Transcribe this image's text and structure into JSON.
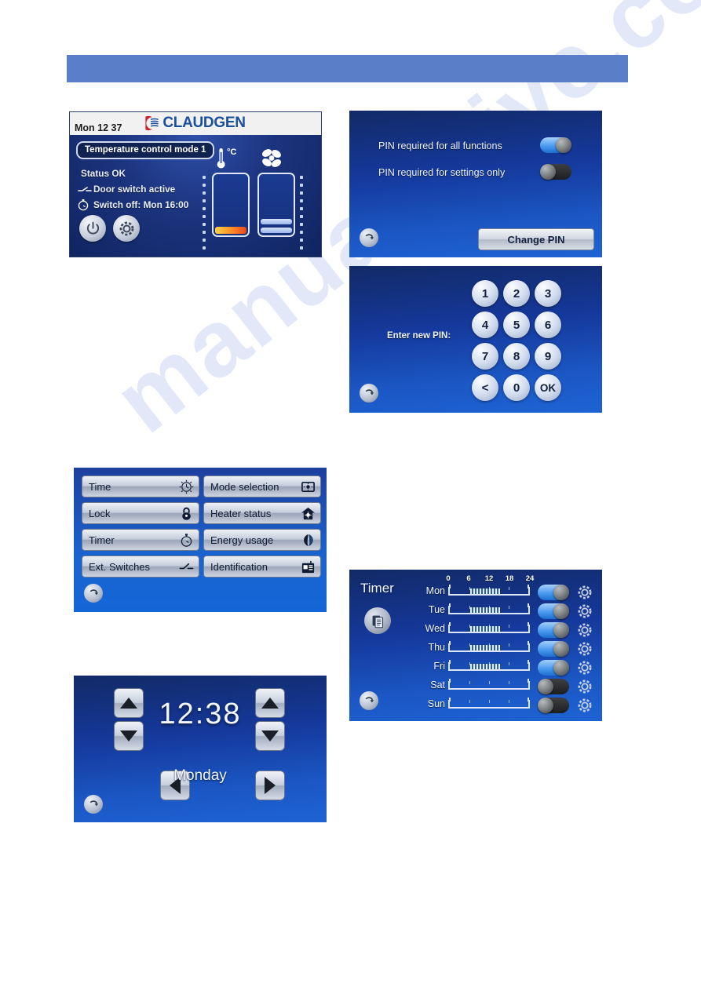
{
  "watermark": "manualshive.com",
  "panel_status": {
    "name": "main-status-screen",
    "clock": "Mon 12 37",
    "brand": "CLAUDGEN",
    "mode_label": "Temperature control mode 1",
    "status_line": "Status OK",
    "door_line": "Door switch active",
    "switchoff_line": "Switch off: Mon 16:00",
    "unit_label": "°C",
    "power_button": "power-icon",
    "settings_button": "gear-icon",
    "temp_gauge_fill_pct": 11,
    "fan_gauge_fill_pcts": [
      9,
      9
    ]
  },
  "panel_pin": {
    "name": "pin-settings-screen",
    "row_all_functions": "PIN required for all functions",
    "row_settings_only": "PIN required for settings only",
    "toggle_all_functions": "on",
    "toggle_settings_only": "off",
    "change_pin_label": "Change PIN",
    "back_label": "back-icon"
  },
  "panel_keypad": {
    "name": "enter-pin-screen",
    "prompt": "Enter new PIN:",
    "keys": [
      "1",
      "2",
      "3",
      "4",
      "5",
      "6",
      "7",
      "8",
      "9",
      "<",
      "0",
      "OK"
    ],
    "back_label": "back-icon"
  },
  "panel_menu": {
    "name": "settings-menu-screen",
    "items_left": [
      {
        "label": "Time",
        "icon": "clock-icon"
      },
      {
        "label": "Lock",
        "icon": "padlock-icon"
      },
      {
        "label": "Timer",
        "icon": "stopwatch-icon"
      },
      {
        "label": "Ext. Switches",
        "icon": "switch-icon"
      }
    ],
    "items_right": [
      {
        "label": "Mode selection",
        "icon": "mode-display-icon"
      },
      {
        "label": "Heater status",
        "icon": "house-heater-icon"
      },
      {
        "label": "Energy usage",
        "icon": "leaf-icon"
      },
      {
        "label": "Identification",
        "icon": "id-card-icon"
      }
    ],
    "back_label": "back-icon"
  },
  "panel_time": {
    "name": "time-setting-screen",
    "time": "12:38",
    "day": "Monday",
    "hour_up": "arrow-up-icon",
    "hour_down": "arrow-down-icon",
    "minute_up": "arrow-up-icon",
    "minute_down": "arrow-down-icon",
    "day_prev": "arrow-left-icon",
    "day_next": "arrow-right-icon",
    "back_label": "back-icon"
  },
  "panel_timer": {
    "name": "timer-schedule-screen",
    "title": "Timer",
    "copy_button": "copy-icon",
    "back_label": "back-icon",
    "scale_ticks": [
      "0",
      "6",
      "12",
      "18",
      "24"
    ],
    "days": [
      {
        "name": "Mon",
        "enabled": true,
        "start_pct": 26,
        "end_pct": 64
      },
      {
        "name": "Tue",
        "enabled": true,
        "start_pct": 26,
        "end_pct": 64
      },
      {
        "name": "Wed",
        "enabled": true,
        "start_pct": 26,
        "end_pct": 64
      },
      {
        "name": "Thu",
        "enabled": true,
        "start_pct": 26,
        "end_pct": 64
      },
      {
        "name": "Fri",
        "enabled": true,
        "start_pct": 26,
        "end_pct": 64
      },
      {
        "name": "Sat",
        "enabled": false,
        "start_pct": 0,
        "end_pct": 0
      },
      {
        "name": "Sun",
        "enabled": false,
        "start_pct": 0,
        "end_pct": 0
      }
    ]
  },
  "colors": {
    "header_band": "#5b7ec9",
    "lcd_blue": "#1b57c4",
    "brand_blue": "#1a4f9c",
    "brand_red": "#cc1f2d",
    "toggle_on": "#4b9bf0"
  }
}
